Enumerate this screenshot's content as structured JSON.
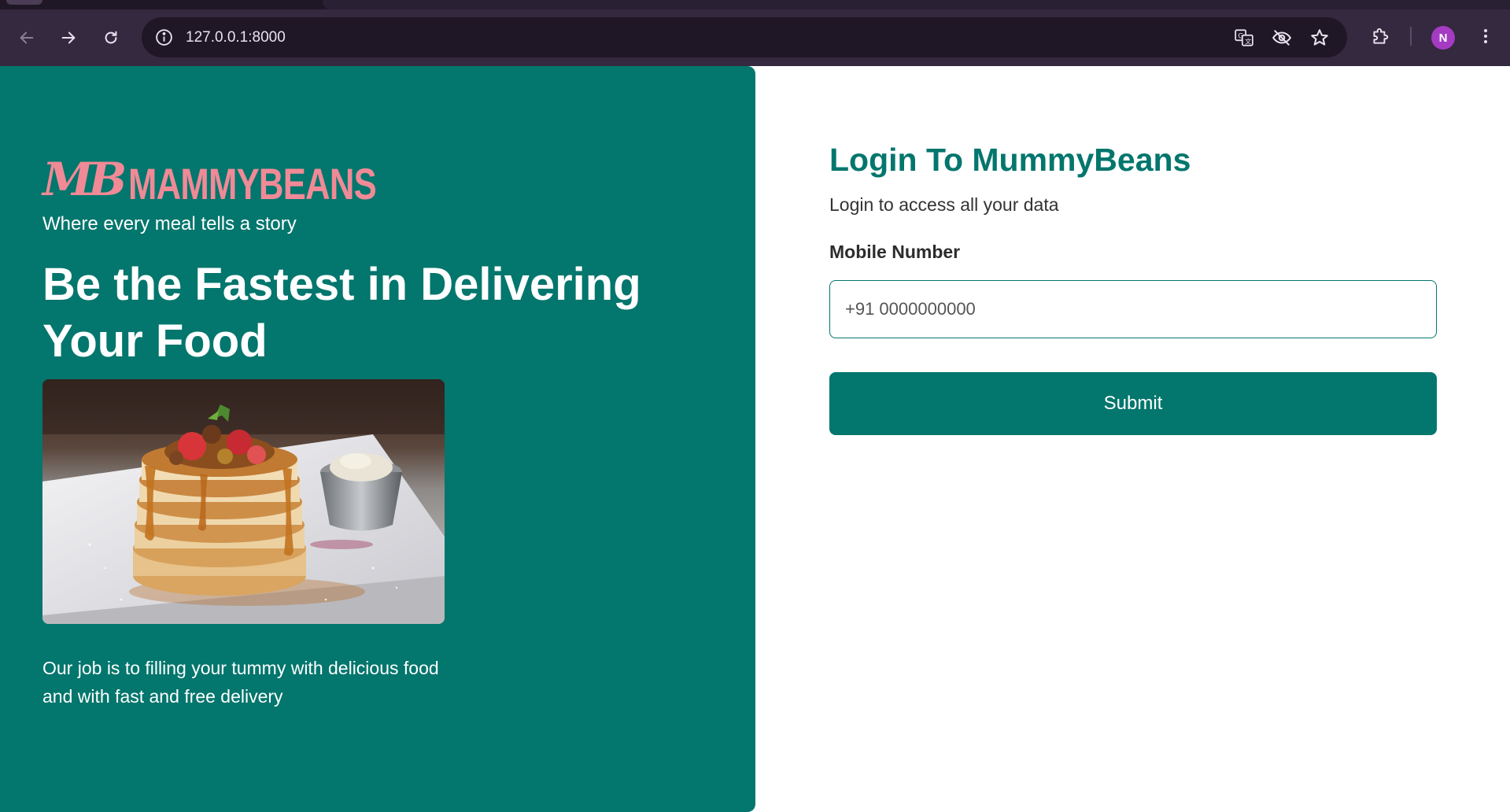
{
  "browser": {
    "url": "127.0.0.1:8000",
    "profile_initial": "N",
    "icons": {
      "back": "arrow-left-icon",
      "forward": "arrow-right-icon",
      "reload": "reload-icon",
      "site_info": "info-icon",
      "translate": "translate-icon",
      "tracking": "eye-off-icon",
      "bookmark": "star-icon",
      "extensions": "puzzle-icon",
      "menu": "kebab-menu-icon"
    }
  },
  "hero": {
    "logo_mark": "MB",
    "logo_text": "MAMMYBEANS",
    "tagline": "Where every meal tells a story",
    "headline": "Be the Fastest in Delivering Your Food",
    "description": "Our job is to filling your tummy with delicious food and with fast and free delivery",
    "accent_color": "#03766d",
    "logo_color": "#f08a96"
  },
  "login": {
    "title": "Login To MummyBeans",
    "subtitle": "Login to access all your data",
    "mobile_label": "Mobile Number",
    "mobile_placeholder": "+91 0000000000",
    "mobile_value": "",
    "submit_label": "Submit"
  }
}
